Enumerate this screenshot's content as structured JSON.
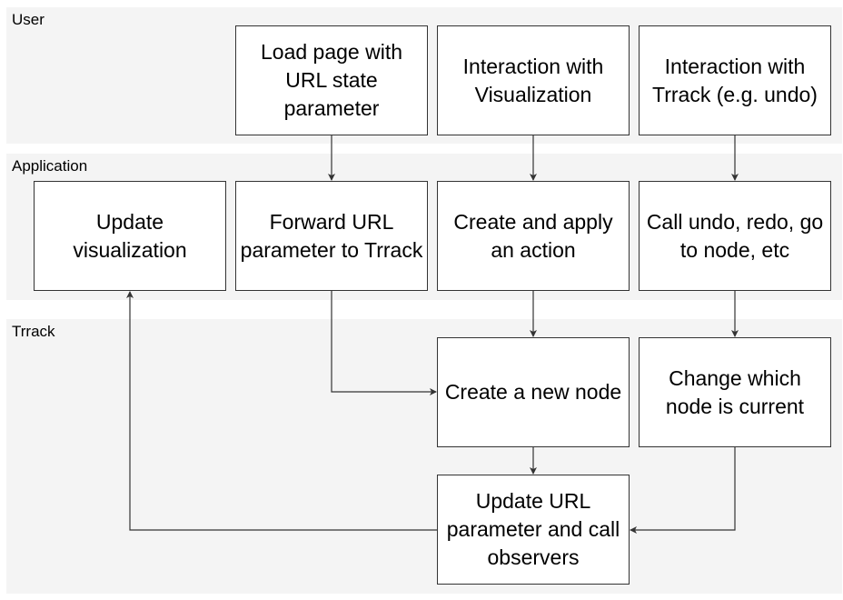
{
  "lanes": {
    "user": "User",
    "application": "Application",
    "trrack": "Trrack"
  },
  "nodes": {
    "load_page": "Load page with URL state parameter",
    "interact_vis": "Interaction with Visualization",
    "interact_trrack": "Interaction with Trrack (e.g. undo)",
    "update_vis": "Update visualization",
    "forward_url": "Forward URL parameter to Trrack",
    "create_action": "Create and apply an action",
    "call_undo": "Call undo, redo, go to node, etc",
    "create_node": "Create a new node",
    "change_current": "Change which node is current",
    "update_url": "Update URL parameter and call observers"
  },
  "colors": {
    "lane_fill": "#f4f4f4",
    "box_border": "#333333",
    "edge": "#333333"
  }
}
